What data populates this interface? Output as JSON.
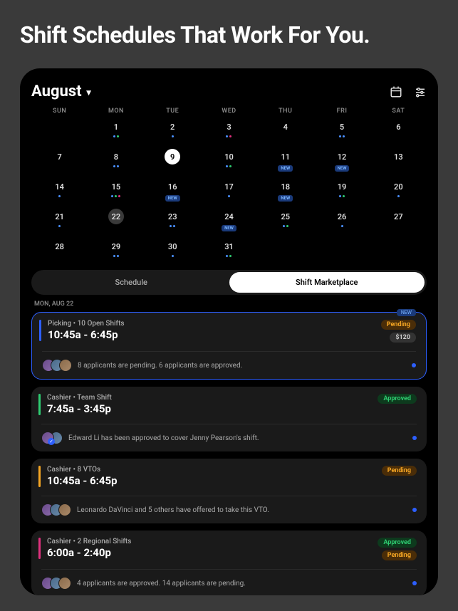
{
  "headline": "Shift Schedules That Work For You.",
  "header": {
    "month": "August",
    "icons": {
      "calendar": "calendar",
      "filter": "filter"
    }
  },
  "weekdays": [
    "SUN",
    "MON",
    "TUE",
    "WED",
    "THU",
    "FRI",
    "SAT"
  ],
  "calendar": {
    "rows": [
      [
        {
          "n": "",
          "dots": []
        },
        {
          "n": "1",
          "dots": [
            "blue",
            "green"
          ]
        },
        {
          "n": "2",
          "dots": [
            "blue"
          ]
        },
        {
          "n": "3",
          "dots": [
            "blue",
            "pink"
          ]
        },
        {
          "n": "4",
          "dots": []
        },
        {
          "n": "5",
          "dots": [
            "blue",
            "blue"
          ]
        },
        {
          "n": "6",
          "dots": []
        }
      ],
      [
        {
          "n": "7",
          "dots": []
        },
        {
          "n": "8",
          "dots": [
            "blue",
            "blue"
          ]
        },
        {
          "n": "9",
          "dots": [],
          "today": true
        },
        {
          "n": "10",
          "dots": [
            "blue",
            "green"
          ]
        },
        {
          "n": "11",
          "dots": [],
          "new": true
        },
        {
          "n": "12",
          "dots": [],
          "new": true
        },
        {
          "n": "13",
          "dots": []
        }
      ],
      [
        {
          "n": "14",
          "dots": [
            "blue"
          ]
        },
        {
          "n": "15",
          "dots": [
            "blue",
            "green",
            "pink"
          ]
        },
        {
          "n": "16",
          "dots": [],
          "new": true
        },
        {
          "n": "17",
          "dots": [
            "blue"
          ]
        },
        {
          "n": "18",
          "dots": [],
          "new": true
        },
        {
          "n": "19",
          "dots": [
            "blue",
            "green"
          ]
        },
        {
          "n": "20",
          "dots": [
            "blue"
          ]
        }
      ],
      [
        {
          "n": "21",
          "dots": [
            "blue"
          ]
        },
        {
          "n": "22",
          "dots": [],
          "selected": true
        },
        {
          "n": "23",
          "dots": [
            "blue",
            "blue"
          ]
        },
        {
          "n": "24",
          "dots": [],
          "new": true
        },
        {
          "n": "25",
          "dots": [
            "blue",
            "green"
          ]
        },
        {
          "n": "26",
          "dots": [
            "blue"
          ]
        },
        {
          "n": "27",
          "dots": [],
          "underlay": "22"
        }
      ],
      [
        {
          "n": "28",
          "dots": []
        },
        {
          "n": "29",
          "dots": [
            "blue",
            "blue"
          ]
        },
        {
          "n": "30",
          "dots": [
            "blue"
          ]
        },
        {
          "n": "31",
          "dots": [
            "blue",
            "green"
          ]
        },
        {
          "n": "",
          "dots": []
        },
        {
          "n": "",
          "dots": []
        },
        {
          "n": "",
          "dots": []
        }
      ]
    ]
  },
  "tabs": {
    "schedule": "Schedule",
    "marketplace": "Shift Marketplace",
    "active": "marketplace"
  },
  "datelabel": "MON, AUG 22",
  "cards": [
    {
      "accent": "blue",
      "bordered": true,
      "new_badge": "NEW",
      "title": "Picking • 10 Open Shifts",
      "time": "10:45a - 6:45p",
      "pills": [
        {
          "kind": "pending",
          "text": "Pending"
        },
        {
          "kind": "price",
          "text": "$120"
        }
      ],
      "foot": "8 applicants are pending. 6 applicants are approved.",
      "avatars": 3
    },
    {
      "accent": "green",
      "title": "Cashier • Team Shift",
      "time": "7:45a - 3:45p",
      "pills": [
        {
          "kind": "approved",
          "text": "Approved"
        }
      ],
      "foot": "Edward Li has been approved to cover Jenny Pearson's shift.",
      "avatars": 2,
      "avcheck": true
    },
    {
      "accent": "yellow",
      "title": "Cashier • 8 VTOs",
      "time": "10:45a - 6:45p",
      "pills": [
        {
          "kind": "pending",
          "text": "Pending"
        }
      ],
      "foot": "Leonardo DaVinci and 5 others have offered to take this VTO.",
      "avatars": 3
    },
    {
      "accent": "pink",
      "title": "Cashier • 2 Regional Shifts",
      "time": "6:00a - 2:40p",
      "pills": [
        {
          "kind": "approved",
          "text": "Approved"
        },
        {
          "kind": "pending",
          "text": "Pending"
        }
      ],
      "foot": "4 applicants are approved. 14 applicants are pending.",
      "avatars": 3
    }
  ]
}
